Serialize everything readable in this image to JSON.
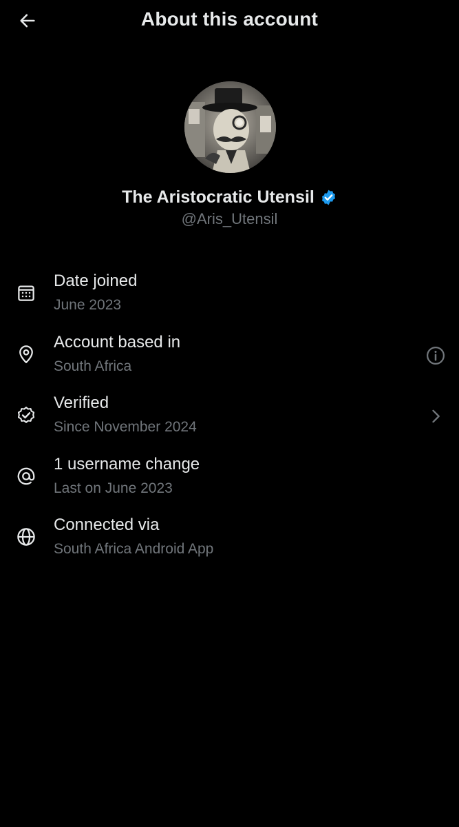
{
  "header": {
    "title": "About this account",
    "back_icon": "arrow-left-icon"
  },
  "profile": {
    "display_name": "The Aristocratic Utensil",
    "handle": "@Aris_Utensil",
    "verified": true,
    "verified_color": "#1d9bf0"
  },
  "rows": [
    {
      "icon": "calendar-icon",
      "title": "Date joined",
      "subtitle": "June 2023"
    },
    {
      "icon": "location-pin-icon",
      "title": "Account based in",
      "subtitle": "South Africa",
      "trailing_icon": "info-icon"
    },
    {
      "icon": "verified-check-icon",
      "title": "Verified",
      "subtitle": "Since November 2024",
      "trailing_icon": "chevron-right-icon"
    },
    {
      "icon": "at-sign-icon",
      "title": "1 username change",
      "subtitle": "Last on June 2023"
    },
    {
      "icon": "globe-icon",
      "title": "Connected via",
      "subtitle": "South Africa Android App"
    }
  ],
  "colors": {
    "background": "#000000",
    "primary_text": "#e7e9ea",
    "secondary_text": "#71767b"
  }
}
